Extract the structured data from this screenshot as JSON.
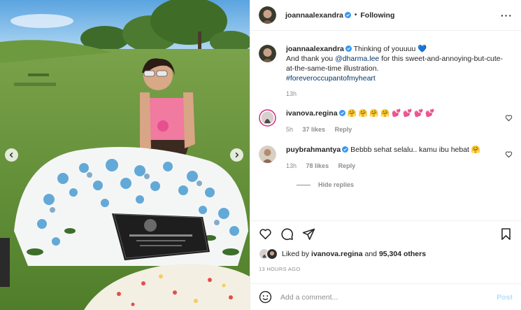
{
  "post": {
    "author": "joannaalexandra",
    "follow_state": "Following",
    "more_icon": "more-horizontal-icon"
  },
  "caption": {
    "author": "joannaalexandra",
    "line1": "Thinking of youuuu",
    "heart_emoji": "💙",
    "thanks_prefix": "And thank you",
    "mention": "@dharma.lee",
    "thanks_suffix": "for this sweet-and-annoying-but-cute-at-the-same-time illustration.",
    "hashtag": "#foreveroccupantofmyheart",
    "time": "13h"
  },
  "comments": [
    {
      "author": "ivanova.regina",
      "verified": true,
      "text": "🤗 🤗 🤗 🤗 💕 💕 💕 💕",
      "time": "5h",
      "likes": "37 likes",
      "reply": "Reply"
    },
    {
      "author": "puybrahmantya",
      "verified": true,
      "text": "Bebbb sehat selalu.. kamu ibu hebat 🤗",
      "time": "13h",
      "likes": "78 likes",
      "reply": "Reply"
    }
  ],
  "hide_replies": "Hide replies",
  "actions": {
    "icons": [
      "heart-icon",
      "comment-icon",
      "share-icon",
      "bookmark-icon"
    ]
  },
  "likes": {
    "prefix": "Liked by",
    "user": "ivanova.regina",
    "joiner": "and",
    "others": "95,304 others"
  },
  "timestamp": "13 HOURS AGO",
  "composer": {
    "placeholder": "Add a comment...",
    "post_label": "Post"
  },
  "colors": {
    "verified": "#3897f0",
    "link": "#00376b",
    "muted": "#8e8e8e",
    "post_disabled": "#b2dffc"
  }
}
